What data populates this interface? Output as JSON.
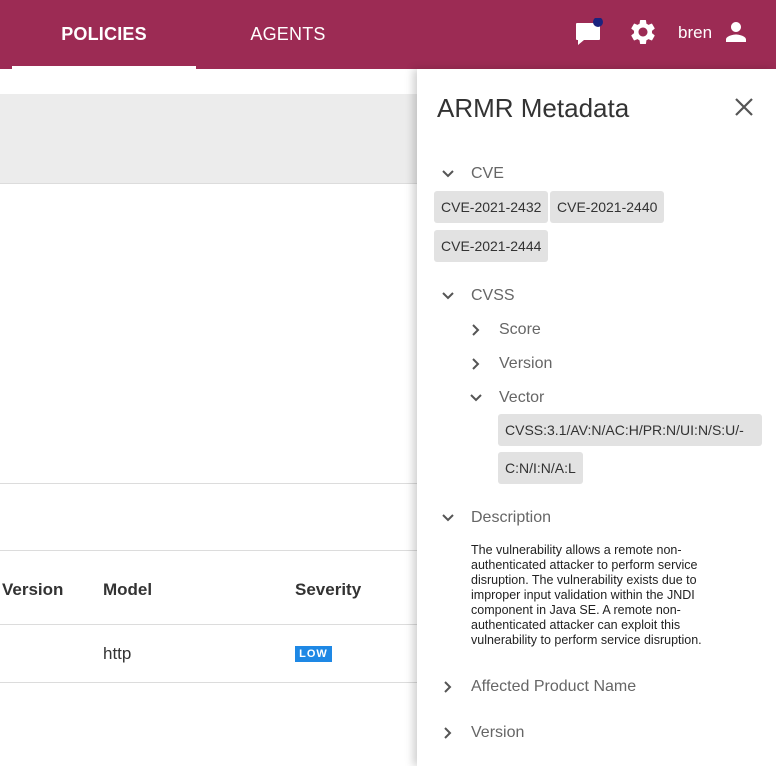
{
  "nav": {
    "tabs": [
      {
        "label": "POLICIES",
        "active": true
      },
      {
        "label": "AGENTS",
        "active": false
      }
    ],
    "user_name": "bren",
    "icons": [
      "chat-icon",
      "gear-icon",
      "user-icon"
    ],
    "brand_color": "#9c2b54",
    "notification_dot_color": "#1a237e"
  },
  "table": {
    "columns": [
      "Version",
      "Model",
      "Severity"
    ],
    "rows": [
      {
        "version": "",
        "model": "http",
        "severity": "LOW"
      }
    ],
    "severity_color": "#1e88e5"
  },
  "panel": {
    "title": "ARMR Metadata",
    "cve": {
      "label": "CVE",
      "expanded": true,
      "items": [
        "CVE-2021-2432",
        "CVE-2021-2440",
        "CVE-2021-2444"
      ]
    },
    "cvss": {
      "label": "CVSS",
      "expanded": true,
      "score_label": "Score",
      "version_label": "Version",
      "vector_label": "Vector",
      "vector_line1": "CVSS:3.1/AV:N/AC:H/PR:N/UI:N/S:U/-",
      "vector_line2": "C:N/I:N/A:L"
    },
    "description": {
      "label": "Description",
      "expanded": true,
      "text": "The vulnerability allows a remote non-authenticated attacker to perform service disruption. The vulnerability exists due to improper input validation within the JNDI component in Java SE. A remote non-authenticated attacker can exploit this vulnerability to perform service disruption."
    },
    "affected_product_label": "Affected Product Name",
    "version_label": "Version"
  }
}
